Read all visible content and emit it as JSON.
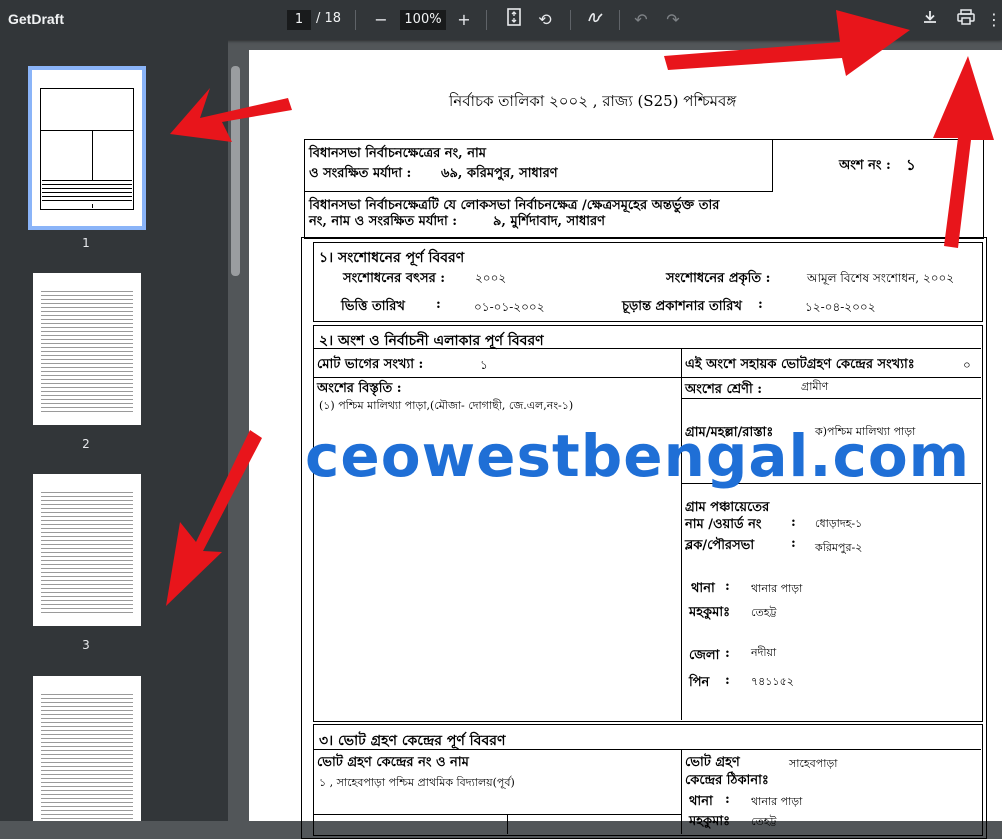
{
  "toolbar": {
    "title": "GetDraft",
    "page_current": "1",
    "page_total": "/ 18",
    "zoom": "100%"
  },
  "sidebar": {
    "thumbs": [
      "1",
      "2",
      "3"
    ]
  },
  "document": {
    "title": "নির্বাচক তালিকা   ২০০২ , রাজ্য (S25) পশ্চিমবঙ্গ",
    "header": {
      "ac_label": "বিধানসভা নির্বাচনক্ষেত্রের নং, নাম",
      "ac_reserved_label": "ও সংরক্ষিত মর্যাদা :",
      "ac_value": "৬৯,  করিমপুর,  সাধারণ",
      "part_label": "অংশ নং :",
      "part_value": "১",
      "pc_line1": "বিধানসভা নির্বাচনক্ষেত্রটি যে লোকসভা নির্বাচনক্ষেত্র /ক্ষেত্রসমূহের অন্তর্ভুক্ত তার",
      "pc_line2": "নং, নাম  ও সংরক্ষিত মর্যাদা :",
      "pc_value": "৯,  মুর্শিদাবাদ,  সাধারণ"
    },
    "section1": {
      "heading": "১। সংশোধনের পূর্ণ বিবরণ",
      "year_label": "সংশোধনের বৎসর :",
      "year_value": "২০০২",
      "nature_label": "সংশোধনের প্রকৃতি :",
      "nature_value": "আমূল বিশেষ সংশোধন, ২০০২",
      "base_date_label": "ভিত্তি তারিখ",
      "base_date_colon": ":",
      "base_date_value": "০১-০১-২০০২",
      "pub_date_label": "চূড়ান্ত প্রকাশনার তারিখ",
      "pub_date_colon": ":",
      "pub_date_value": "১২-০৪-২০০২"
    },
    "section2": {
      "heading": "২। অংশ ও নির্বাচনী এলাকার পূর্ণ বিবরণ",
      "total_sections_label": "মোট ভাগের সংখ্যা :",
      "total_sections_value": "১",
      "aux_label": "এই অংশে সহায়ক ভোটগ্রহণ কেন্দ্রের সংখ্যাঃ",
      "aux_value": "০",
      "extent_label": "অংশের বিস্তৃতি  :",
      "extent_value": "(১) পশ্চিম মালিথ্যা পাড়া,(মৌজা- দোগাছী, জে.এল,নং-১)",
      "category_label": "অংশের শ্রেণী :",
      "category_value": "গ্রামীণ",
      "village_label": "গ্রাম/মহল্লা/রাস্তাঃ",
      "village_value": "ক)পশ্চিম মালিথ্যা পাড়া",
      "gp_label1": "গ্রাম পঞ্চায়েতের",
      "gp_label2": "নাম /ওয়ার্ড নং",
      "gp_colon": ":",
      "gp_value": "ধোড়াদহ-১",
      "block_label": "ব্লক/পৌরসভা",
      "block_colon": ":",
      "block_value": "করিমপুর-২",
      "ps_label": "থানা",
      "ps_colon": ":",
      "ps_value": "থানার পাড়া",
      "subdiv_label": "মহকুমাঃ",
      "subdiv_value": "তেহট্ট",
      "district_label": "জেলা",
      "district_colon": ":",
      "district_value": "নদীয়া",
      "pin_label": "পিন",
      "pin_colon": ":",
      "pin_value": "৭৪১১৫২"
    },
    "section3": {
      "heading": "৩। ভোট গ্রহণ কেন্দ্রের পূর্ণ বিবরণ",
      "station_label": "ভোট গ্রহণ কেন্দ্রের নং ও নাম",
      "station_value": "১ , সাহেবপাড়া পশ্চিম প্রাথমিক বিদ্যালয়(পূর্ব)",
      "addr_label1": "ভোট গ্রহণ",
      "addr_label2": "কেন্দ্রের ঠিকানাঃ",
      "addr_value": "সাহেবপাড়া",
      "ps_label": "থানা",
      "ps_colon": ":",
      "ps_value": "থানার পাড়া",
      "subdiv_label": "মহকুমাঃ",
      "subdiv_value": "তেহট্ট"
    },
    "watermark": "ceowestbengal.com"
  },
  "colors": {
    "toolbar_bg": "#323639",
    "viewer_bg": "#525659",
    "selected_thumb": "#8ab4f8",
    "watermark": "#1f6fd6",
    "arrow": "#e8151b"
  }
}
